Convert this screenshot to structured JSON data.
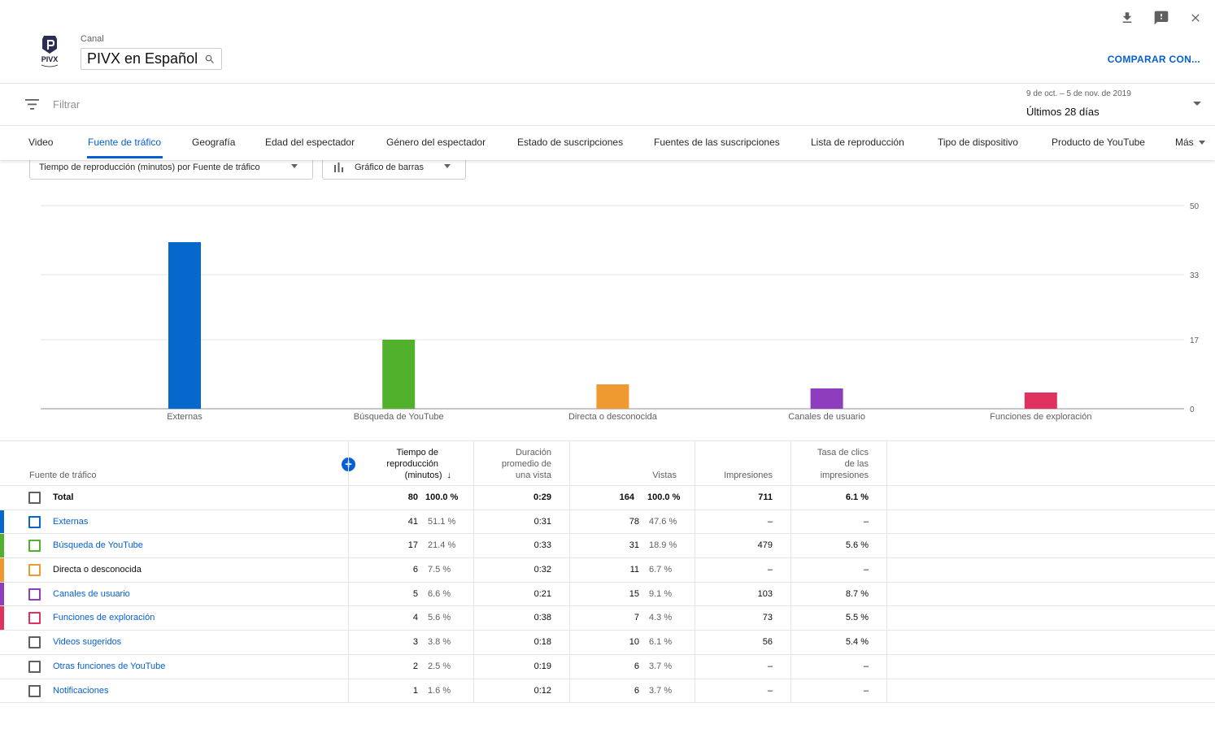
{
  "header": {
    "canal_label": "Canal",
    "channel_name": "PIVX en Español",
    "logo_text": "PIVX",
    "compare_label": "COMPARAR CON...",
    "icons": [
      "download-icon",
      "feedback-icon",
      "close-icon"
    ]
  },
  "filter": {
    "placeholder": "Filtrar",
    "date_range": "9 de oct. – 5 de nov. de 2019",
    "period": "Últimos 28 días"
  },
  "tabs": [
    "Video",
    "Fuente de tráfico",
    "Geografía",
    "Edad del espectador",
    "Género del espectador",
    "Estado de suscripciones",
    "Fuentes de las suscripciones",
    "Lista de reproducción",
    "Tipo de dispositivo",
    "Producto de YouTube",
    "Más"
  ],
  "active_tab": "Fuente de tráfico",
  "controls": {
    "metric": "Tiempo de reproducción (minutos) por Fuente de tráfico",
    "chart_type": "Gráfico de barras"
  },
  "chart_data": {
    "type": "bar",
    "categories": [
      "Externas",
      "Búsqueda de YouTube",
      "Directa o desconocida",
      "Canales de usuario",
      "Funciones de exploración"
    ],
    "values": [
      41,
      17,
      6,
      5,
      4
    ],
    "colors": [
      "#0468cc",
      "#52b12c",
      "#ef9a31",
      "#8e3ebc",
      "#e0325f"
    ],
    "yticks": [
      0,
      17,
      33,
      50
    ],
    "ylim": [
      0,
      50
    ],
    "grid": true
  },
  "table": {
    "headers": {
      "source": "Fuente de tráfico",
      "watch_time": [
        "Tiempo de",
        "reproducción",
        "(minutos)"
      ],
      "avg_duration": [
        "Duración",
        "promedio de",
        "una vista"
      ],
      "views": "Vistas",
      "impressions": "Impresiones",
      "ctr": [
        "Tasa de clics",
        "de las",
        "impresiones"
      ]
    },
    "total": {
      "name": "Total",
      "watch_time": "80",
      "watch_pct": "100.0 %",
      "avg": "0:29",
      "views": "164",
      "views_pct": "100.0 %",
      "impressions": "711",
      "ctr": "6.1 %"
    },
    "rows": [
      {
        "name": "Externas",
        "color": "#0468cc",
        "link": true,
        "watch_time": "41",
        "watch_pct": "51.1 %",
        "avg": "0:31",
        "views": "78",
        "views_pct": "47.6 %",
        "impressions": "–",
        "ctr": "–"
      },
      {
        "name": "Búsqueda de YouTube",
        "color": "#52b12c",
        "link": true,
        "watch_time": "17",
        "watch_pct": "21.4 %",
        "avg": "0:33",
        "views": "31",
        "views_pct": "18.9 %",
        "impressions": "479",
        "ctr": "5.6 %"
      },
      {
        "name": "Directa o desconocida",
        "color": "#ef9a31",
        "link": false,
        "watch_time": "6",
        "watch_pct": "7.5 %",
        "avg": "0:32",
        "views": "11",
        "views_pct": "6.7 %",
        "impressions": "–",
        "ctr": "–"
      },
      {
        "name": "Canales de usuario",
        "color": "#8e3ebc",
        "link": true,
        "watch_time": "5",
        "watch_pct": "6.6 %",
        "avg": "0:21",
        "views": "15",
        "views_pct": "9.1 %",
        "impressions": "103",
        "ctr": "8.7 %"
      },
      {
        "name": "Funciones de exploración",
        "color": "#e0325f",
        "link": true,
        "watch_time": "4",
        "watch_pct": "5.6 %",
        "avg": "0:38",
        "views": "7",
        "views_pct": "4.3 %",
        "impressions": "73",
        "ctr": "5.5 %"
      },
      {
        "name": "Videos sugeridos",
        "color": "",
        "link": true,
        "watch_time": "3",
        "watch_pct": "3.8 %",
        "avg": "0:18",
        "views": "10",
        "views_pct": "6.1 %",
        "impressions": "56",
        "ctr": "5.4 %"
      },
      {
        "name": "Otras funciones de YouTube",
        "color": "",
        "link": true,
        "watch_time": "2",
        "watch_pct": "2.5 %",
        "avg": "0:19",
        "views": "6",
        "views_pct": "3.7 %",
        "impressions": "–",
        "ctr": "–"
      },
      {
        "name": "Notificaciones",
        "color": "",
        "link": true,
        "watch_time": "1",
        "watch_pct": "1.6 %",
        "avg": "0:12",
        "views": "6",
        "views_pct": "3.7 %",
        "impressions": "–",
        "ctr": "–"
      }
    ]
  }
}
